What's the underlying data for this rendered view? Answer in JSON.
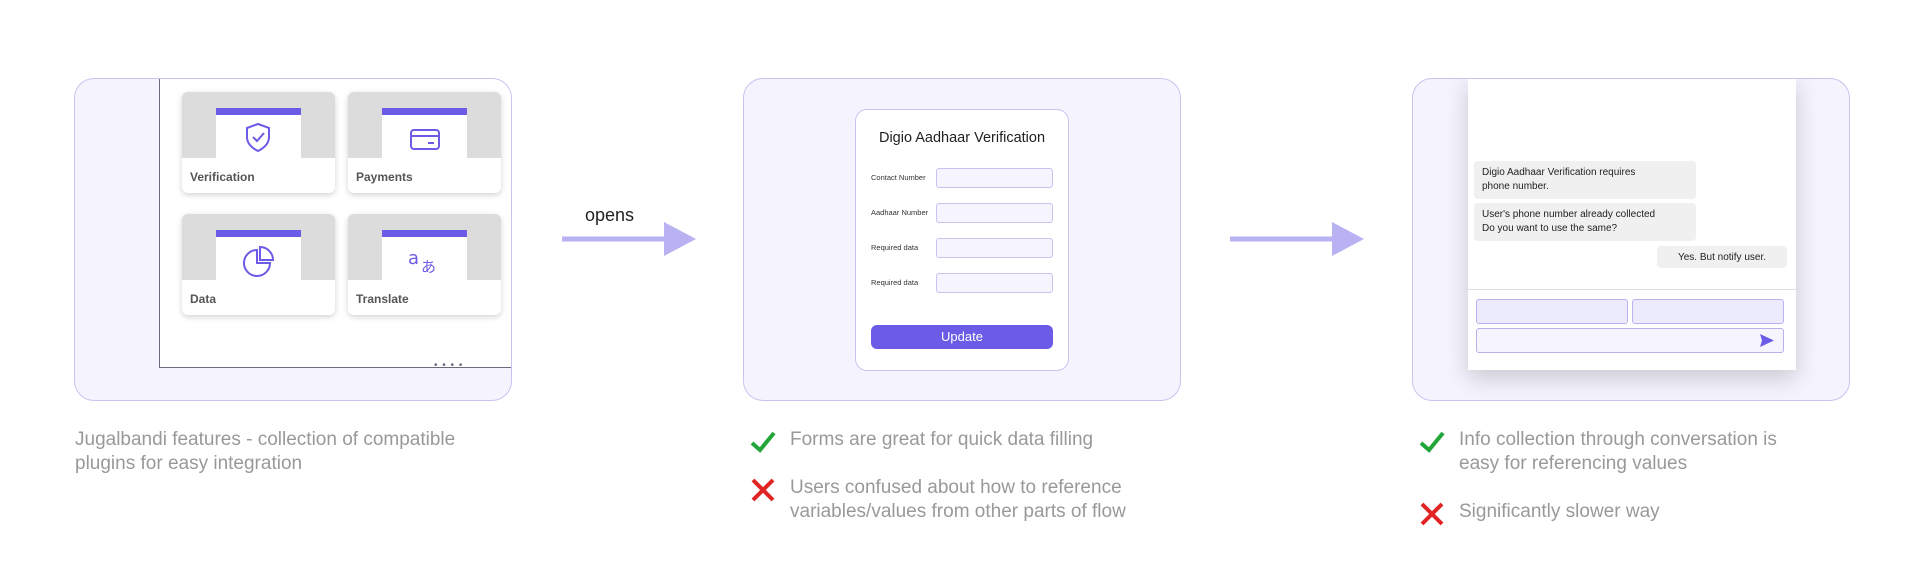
{
  "panel1": {
    "plugins": [
      {
        "label": "Verification",
        "icon": "shield-check-icon"
      },
      {
        "label": "Payments",
        "icon": "credit-card-icon"
      },
      {
        "label": "Data",
        "icon": "pie-chart-icon"
      },
      {
        "label": "Translate",
        "icon": "translate-icon"
      }
    ],
    "dots": "• • • •",
    "caption": [
      "Jugalbandi features - collection of compatible",
      "plugins for easy integration"
    ]
  },
  "arrow1_label": "opens",
  "panel2": {
    "form_title": "Digio Aadhaar Verification",
    "fields": [
      "Contact Number",
      "Aadhaar Number",
      "Required data",
      "Required data"
    ],
    "button": "Update",
    "pro": "Forms are great for quick data filling",
    "con": [
      "Users confused about how to reference",
      "variables/values from other parts of flow"
    ]
  },
  "panel3": {
    "messages": [
      {
        "line1": "Digio Aadhaar Verification requires",
        "line2": "phone number."
      },
      {
        "line1": "User's phone number already collected",
        "line2": "Do you want to use the same?"
      },
      {
        "line1": "Yes. But notify user."
      }
    ],
    "pro": [
      "Info collection through conversation is",
      "easy for referencing values"
    ],
    "con": "Significantly slower way"
  },
  "colors": {
    "accent": "#6b5be6",
    "arrow": "#b9b2f2",
    "panel_bg": "#f5f3fd",
    "panel_border": "#c9c3f0",
    "check": "#22a63a",
    "cross": "#e02424"
  }
}
